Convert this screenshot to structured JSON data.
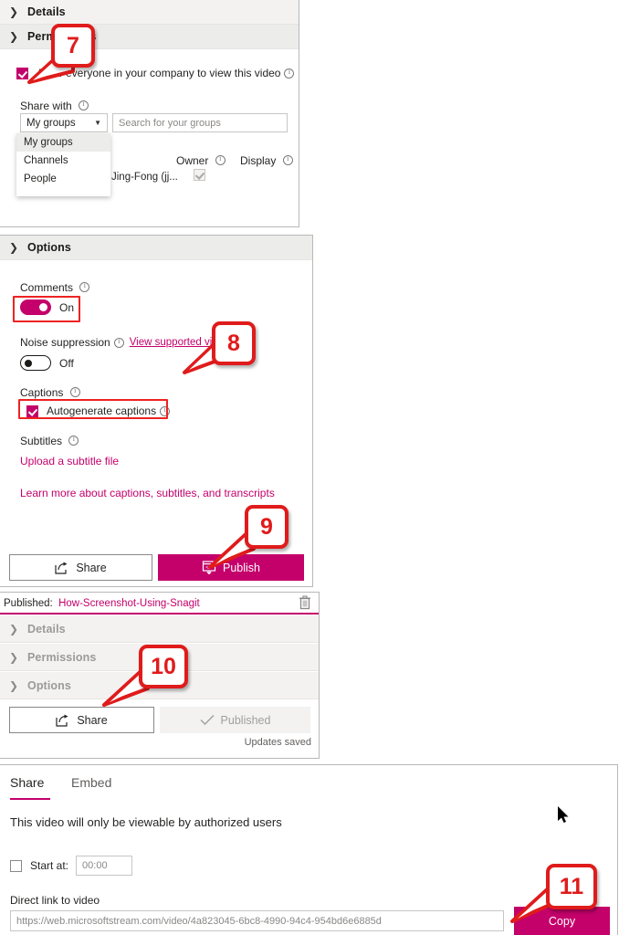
{
  "permissions_panel": {
    "details_header": "Details",
    "permissions_header": "Permissions",
    "allow_everyone_label": "Allow everyone in your company to view this video",
    "share_with_label": "Share with",
    "dropdown_selected": "My groups",
    "dropdown_options": [
      "My groups",
      "Channels",
      "People"
    ],
    "search_placeholder": "Search for your groups",
    "col_owner": "Owner",
    "col_display": "Display",
    "row_name": "Jing-Fong (jj..."
  },
  "options_panel": {
    "options_header": "Options",
    "comments_label": "Comments",
    "comments_state": "On",
    "noise_label": "Noise suppression",
    "noise_link": "View supported vi",
    "noise_state": "Off",
    "captions_label": "Captions",
    "autogenerate_label": "Autogenerate captions",
    "subtitles_label": "Subtitles",
    "upload_link": "Upload a subtitle file",
    "learn_more_link": "Learn more about captions, subtitles, and transcripts",
    "share_button": "Share",
    "publish_button": "Publish"
  },
  "published_panel": {
    "published_prefix": "Published:",
    "published_name": "How-Screenshot-Using-Snagit",
    "details_header": "Details",
    "permissions_header": "Permissions",
    "options_header": "Options",
    "share_button": "Share",
    "published_button": "Published",
    "updates_saved": "Updates saved"
  },
  "share_dialog": {
    "tab_share": "Share",
    "tab_embed": "Embed",
    "notice": "This video will only be viewable by authorized users",
    "start_at_label": "Start at:",
    "start_at_placeholder": "00:00",
    "direct_link_label": "Direct link to video",
    "direct_link_value": "https://web.microsoftstream.com/video/4a823045-6bc8-4990-94c4-954bd6e6885d",
    "copy_button": "Copy"
  },
  "callouts": [
    {
      "number": "7"
    },
    {
      "number": "8"
    },
    {
      "number": "9"
    },
    {
      "number": "10"
    },
    {
      "number": "11"
    }
  ],
  "colors": {
    "accent": "#c4006b",
    "callout_red": "#e01b1b",
    "header_bg": "#f3f2f1"
  }
}
